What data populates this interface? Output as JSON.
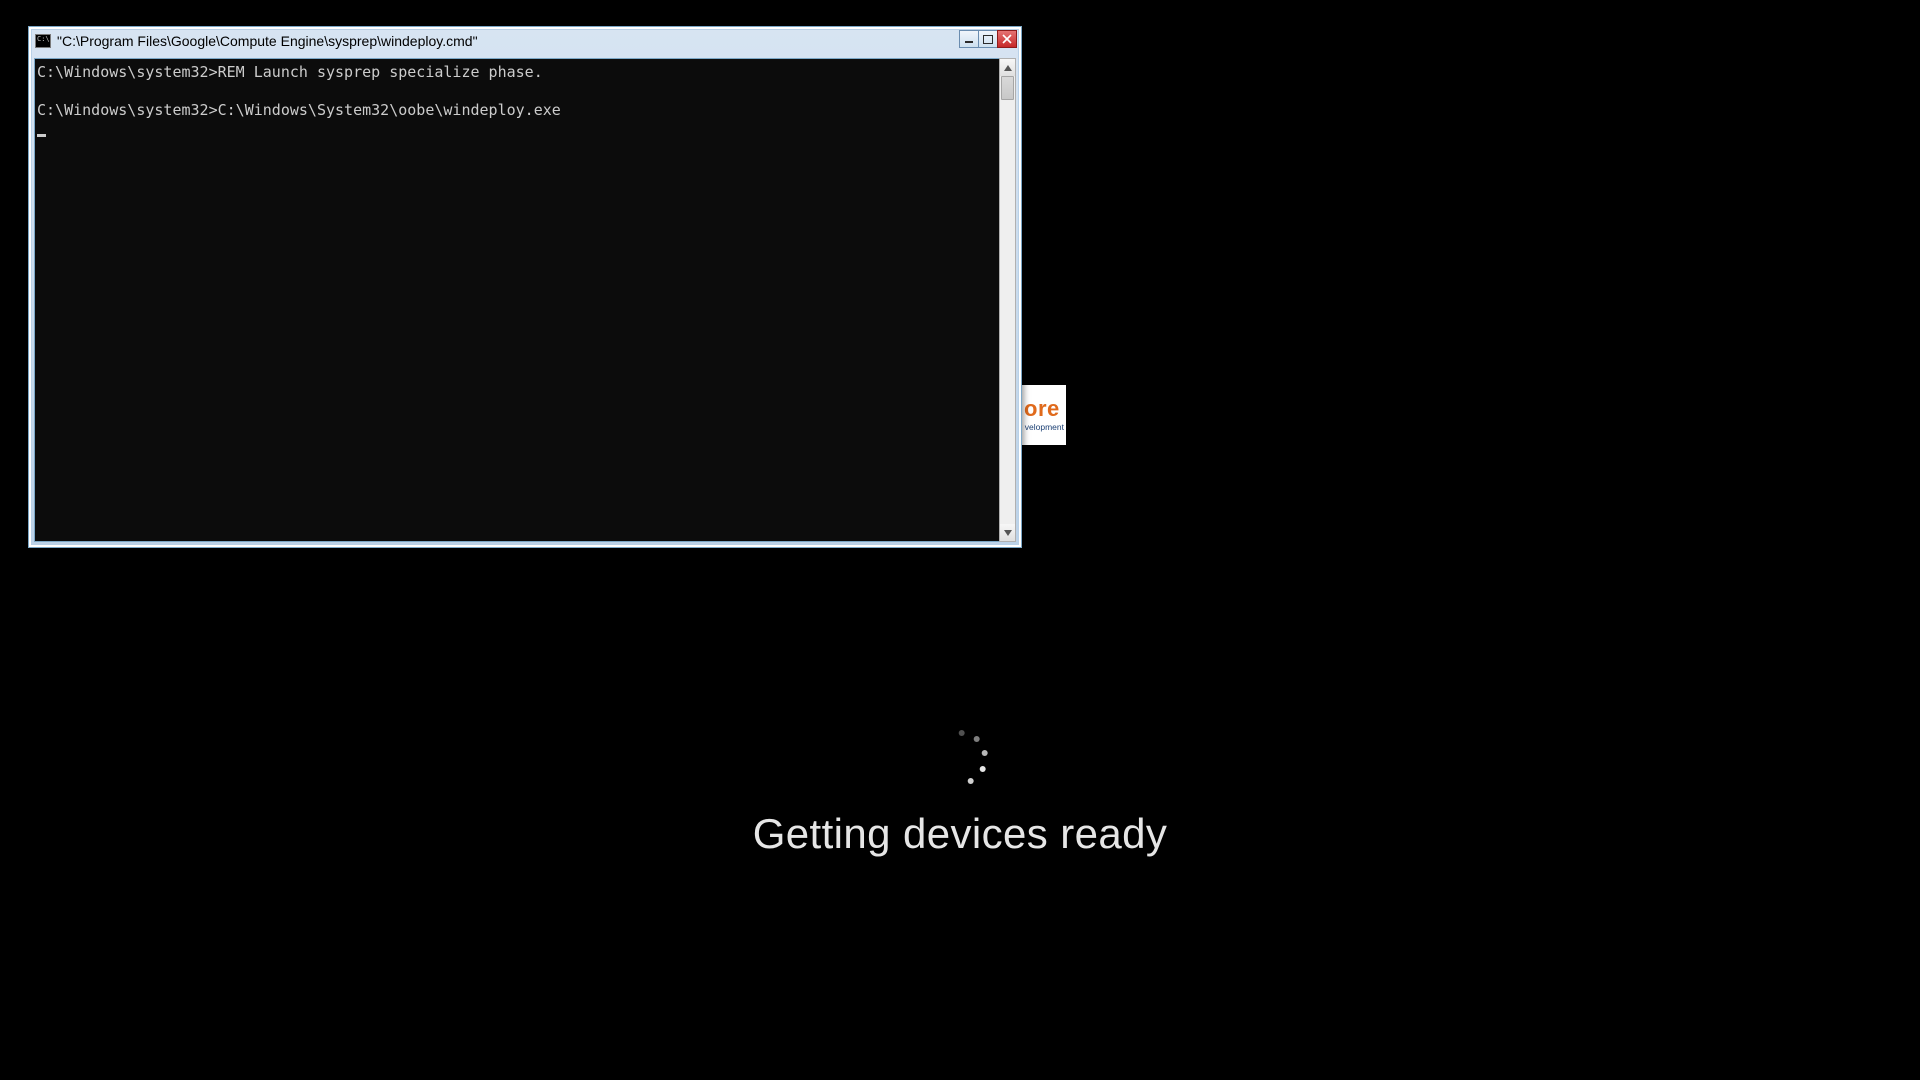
{
  "cmd_window": {
    "icon_label": "C:\\",
    "title": "\"C:\\Program Files\\Google\\Compute Engine\\sysprep\\windeploy.cmd\"",
    "terminal_lines": [
      "C:\\Windows\\system32>REM Launch sysprep specialize phase.",
      "",
      "C:\\Windows\\system32>C:\\Windows\\System32\\oobe\\windeploy.exe"
    ]
  },
  "hidden_tile": {
    "fragment_large": "ore",
    "fragment_small": "velopment",
    "accent_color": "#e06a1c",
    "secondary_color": "#1b3f73"
  },
  "oobe": {
    "message": "Getting devices ready"
  },
  "colors": {
    "desktop_bg": "#000000",
    "window_frame_light": "#d7e4f2",
    "window_frame_dark": "#bcd2e8",
    "close_btn": "#c62828"
  }
}
